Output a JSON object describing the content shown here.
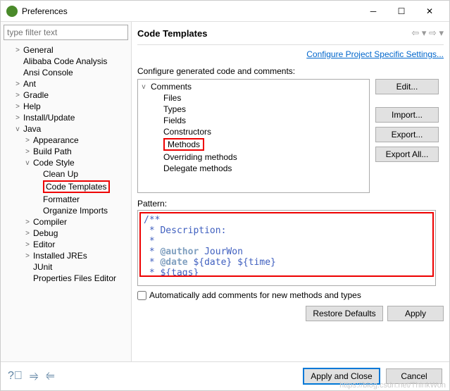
{
  "window": {
    "title": "Preferences"
  },
  "filter": {
    "placeholder": "type filter text"
  },
  "tree": [
    {
      "label": "General",
      "depth": 1,
      "twisty": ">"
    },
    {
      "label": "Alibaba Code Analysis",
      "depth": 1,
      "twisty": ""
    },
    {
      "label": "Ansi Console",
      "depth": 1,
      "twisty": ""
    },
    {
      "label": "Ant",
      "depth": 1,
      "twisty": ">"
    },
    {
      "label": "Gradle",
      "depth": 1,
      "twisty": ">"
    },
    {
      "label": "Help",
      "depth": 1,
      "twisty": ">"
    },
    {
      "label": "Install/Update",
      "depth": 1,
      "twisty": ">"
    },
    {
      "label": "Java",
      "depth": 1,
      "twisty": "v"
    },
    {
      "label": "Appearance",
      "depth": 2,
      "twisty": ">"
    },
    {
      "label": "Build Path",
      "depth": 2,
      "twisty": ">"
    },
    {
      "label": "Code Style",
      "depth": 2,
      "twisty": "v"
    },
    {
      "label": "Clean Up",
      "depth": 3,
      "twisty": ""
    },
    {
      "label": "Code Templates",
      "depth": 3,
      "twisty": "",
      "hl": true
    },
    {
      "label": "Formatter",
      "depth": 3,
      "twisty": ""
    },
    {
      "label": "Organize Imports",
      "depth": 3,
      "twisty": ""
    },
    {
      "label": "Compiler",
      "depth": 2,
      "twisty": ">"
    },
    {
      "label": "Debug",
      "depth": 2,
      "twisty": ">"
    },
    {
      "label": "Editor",
      "depth": 2,
      "twisty": ">"
    },
    {
      "label": "Installed JREs",
      "depth": 2,
      "twisty": ">"
    },
    {
      "label": "JUnit",
      "depth": 2,
      "twisty": ""
    },
    {
      "label": "Properties Files Editor",
      "depth": 2,
      "twisty": ""
    }
  ],
  "page": {
    "title": "Code Templates",
    "configure_link": "Configure Project Specific Settings...",
    "desc": "Configure generated code and comments:",
    "codetree": [
      {
        "label": "Comments",
        "depth": 0,
        "twisty": "v"
      },
      {
        "label": "Files",
        "depth": 1
      },
      {
        "label": "Types",
        "depth": 1
      },
      {
        "label": "Fields",
        "depth": 1
      },
      {
        "label": "Constructors",
        "depth": 1
      },
      {
        "label": "Methods",
        "depth": 1,
        "hl": true
      },
      {
        "label": "Overriding methods",
        "depth": 1
      },
      {
        "label": "Delegate methods",
        "depth": 1
      }
    ],
    "buttons": {
      "edit": "Edit...",
      "import": "Import...",
      "export": "Export...",
      "export_all": "Export All..."
    },
    "pattern_label": "Pattern:",
    "pattern_lines": [
      {
        "t": "/**",
        "cls": "c-comm"
      },
      {
        "t": " * Description:",
        "cls": "c-comm"
      },
      {
        "t": " *",
        "cls": "c-comm"
      }
    ],
    "pattern_author_prefix": " * ",
    "pattern_author_tag": "@author",
    "pattern_author_val": " JourWon",
    "pattern_date_prefix": " * ",
    "pattern_date_tag": "@date",
    "pattern_date_val": " ${date} ${time}",
    "pattern_tags": " * ${tags}",
    "auto_comment": "Automatically add comments for new methods and types",
    "restore": "Restore Defaults",
    "apply": "Apply"
  },
  "footer": {
    "apply_close": "Apply and Close",
    "cancel": "Cancel"
  },
  "watermark": "https://blog.csdn.net/ThinkWon"
}
